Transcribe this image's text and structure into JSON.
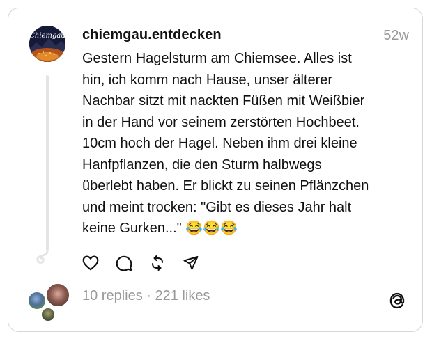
{
  "post": {
    "username": "chiemgau.entdecken",
    "timestamp": "52w",
    "avatar_text": "Chiemgau",
    "text": "Gestern Hagelsturm am Chiemsee. Alles ist\nhin, ich komm nach Hause, unser älterer\nNachbar sitzt mit nackten Füßen mit Weißbier\nin der Hand vor seinem zerstörten Hochbeet.\n10cm hoch der Hagel. Neben ihm drei kleine\nHanfpflanzen, die den Sturm halbwegs\nüberlebt haben. Er blickt zu seinen Pflänzchen\nund meint trocken: \"Gibt es dieses Jahr halt\nkeine Gurken...\" 😂😂😂"
  },
  "actions": {
    "like": "heart-icon",
    "reply": "comment-icon",
    "repost": "repost-icon",
    "share": "share-icon"
  },
  "stats": {
    "replies": "10 replies",
    "separator": " · ",
    "likes": "221 likes"
  },
  "brand": {
    "logo": "threads-logo-icon"
  },
  "colors": {
    "text": "#101010",
    "muted": "#999999",
    "border": "#d6d6d6",
    "thread_line": "#e4e4e4"
  }
}
